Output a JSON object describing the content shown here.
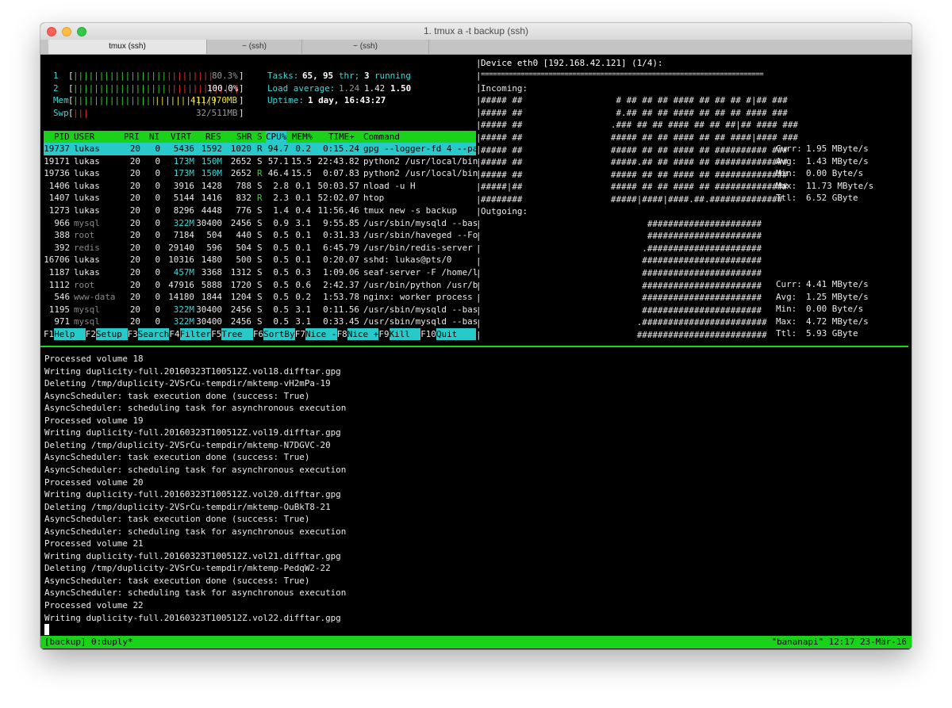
{
  "window": {
    "title": "1. tmux a -t backup (ssh)"
  },
  "tabs": [
    {
      "label": "tmux (ssh)"
    },
    {
      "label": "~ (ssh)"
    },
    {
      "label": "~ (ssh)"
    }
  ],
  "htop": {
    "cpu1": {
      "label": "1",
      "percent_text": "80.3%",
      "percent": 80.3
    },
    "cpu2": {
      "label": "2",
      "percent_text": "100.0%",
      "percent": 100.0
    },
    "mem": {
      "label": "Mem",
      "text": "411/970MB",
      "used": 411,
      "total": 970
    },
    "swp": {
      "label": "Swp",
      "text": "32/511MB",
      "used": 32,
      "total": 511
    },
    "tasks": {
      "label": "Tasks:",
      "count": "65,",
      "thr": "95",
      "thr_label": "thr;",
      "running": "3",
      "running_label": "running"
    },
    "load": {
      "label": "Load average:",
      "v1": "1.24",
      "v2": "1.42",
      "v3": "1.50"
    },
    "uptime": {
      "label": "Uptime:",
      "value": "1 day, 16:43:27"
    },
    "columns": [
      "PID",
      "USER",
      "PRI",
      "NI",
      "VIRT",
      "RES",
      "SHR",
      "S",
      "CPU%",
      "MEM%",
      "TIME+",
      "Command"
    ],
    "processes": [
      {
        "pid": "19737",
        "user": "lukas",
        "pri": "20",
        "ni": "0",
        "virt": "5436",
        "res": "1592",
        "shr": "1020",
        "s": "R",
        "cpu": "94.7",
        "mem": "0.2",
        "time": "0:15.24",
        "cmd": "gpg --logger-fd 4 --pa"
      },
      {
        "pid": "19171",
        "user": "lukas",
        "pri": "20",
        "ni": "0",
        "virt": "173M",
        "res": "150M",
        "shr": "2652",
        "s": "S",
        "cpu": "57.1",
        "mem": "15.5",
        "time": "22:43.82",
        "cmd": "python2 /usr/local/bin"
      },
      {
        "pid": "19736",
        "user": "lukas",
        "pri": "20",
        "ni": "0",
        "virt": "173M",
        "res": "150M",
        "shr": "2652",
        "s": "R",
        "cpu": "46.4",
        "mem": "15.5",
        "time": "0:07.83",
        "cmd": "python2 /usr/local/bin"
      },
      {
        "pid": "1406",
        "user": "lukas",
        "pri": "20",
        "ni": "0",
        "virt": "3916",
        "res": "1428",
        "shr": "788",
        "s": "S",
        "cpu": "2.8",
        "mem": "0.1",
        "time": "50:03.57",
        "cmd": "nload -u H"
      },
      {
        "pid": "1407",
        "user": "lukas",
        "pri": "20",
        "ni": "0",
        "virt": "5144",
        "res": "1416",
        "shr": "832",
        "s": "R",
        "cpu": "2.3",
        "mem": "0.1",
        "time": "52:02.07",
        "cmd": "htop"
      },
      {
        "pid": "1273",
        "user": "lukas",
        "pri": "20",
        "ni": "0",
        "virt": "8296",
        "res": "4448",
        "shr": "776",
        "s": "S",
        "cpu": "1.4",
        "mem": "0.4",
        "time": "11:56.46",
        "cmd": "tmux new -s backup"
      },
      {
        "pid": "966",
        "user": "mysql",
        "pri": "20",
        "ni": "0",
        "virt": "322M",
        "res": "30400",
        "shr": "2456",
        "s": "S",
        "cpu": "0.9",
        "mem": "3.1",
        "time": "9:55.85",
        "cmd": "/usr/sbin/mysqld --bas"
      },
      {
        "pid": "388",
        "user": "root",
        "pri": "20",
        "ni": "0",
        "virt": "7184",
        "res": "504",
        "shr": "440",
        "s": "S",
        "cpu": "0.5",
        "mem": "0.1",
        "time": "0:31.33",
        "cmd": "/usr/sbin/haveged --Fo"
      },
      {
        "pid": "392",
        "user": "redis",
        "pri": "20",
        "ni": "0",
        "virt": "29140",
        "res": "596",
        "shr": "504",
        "s": "S",
        "cpu": "0.5",
        "mem": "0.1",
        "time": "6:45.79",
        "cmd": "/usr/bin/redis-server"
      },
      {
        "pid": "16706",
        "user": "lukas",
        "pri": "20",
        "ni": "0",
        "virt": "10316",
        "res": "1480",
        "shr": "500",
        "s": "S",
        "cpu": "0.5",
        "mem": "0.1",
        "time": "0:20.07",
        "cmd": "sshd: lukas@pts/0"
      },
      {
        "pid": "1187",
        "user": "lukas",
        "pri": "20",
        "ni": "0",
        "virt": "457M",
        "res": "3368",
        "shr": "1312",
        "s": "S",
        "cpu": "0.5",
        "mem": "0.3",
        "time": "1:09.06",
        "cmd": "seaf-server -F /home/l"
      },
      {
        "pid": "1112",
        "user": "root",
        "pri": "20",
        "ni": "0",
        "virt": "47916",
        "res": "5888",
        "shr": "1720",
        "s": "S",
        "cpu": "0.5",
        "mem": "0.6",
        "time": "2:42.37",
        "cmd": "/usr/bin/python /usr/b"
      },
      {
        "pid": "546",
        "user": "www-data",
        "pri": "20",
        "ni": "0",
        "virt": "14180",
        "res": "1844",
        "shr": "1204",
        "s": "S",
        "cpu": "0.5",
        "mem": "0.2",
        "time": "1:53.78",
        "cmd": "nginx: worker process"
      },
      {
        "pid": "1195",
        "user": "mysql",
        "pri": "20",
        "ni": "0",
        "virt": "322M",
        "res": "30400",
        "shr": "2456",
        "s": "S",
        "cpu": "0.5",
        "mem": "3.1",
        "time": "0:11.56",
        "cmd": "/usr/sbin/mysqld --bas"
      },
      {
        "pid": "971",
        "user": "mysql",
        "pri": "20",
        "ni": "0",
        "virt": "322M",
        "res": "30400",
        "shr": "2456",
        "s": "S",
        "cpu": "0.5",
        "mem": "3.1",
        "time": "0:33.45",
        "cmd": "/usr/sbin/mysqld --bas"
      }
    ],
    "fkeys": [
      {
        "key": "F1",
        "label": "Help"
      },
      {
        "key": "F2",
        "label": "Setup"
      },
      {
        "key": "F3",
        "label": "Search"
      },
      {
        "key": "F4",
        "label": "Filter"
      },
      {
        "key": "F5",
        "label": "Tree"
      },
      {
        "key": "F6",
        "label": "SortBy"
      },
      {
        "key": "F7",
        "label": "Nice -"
      },
      {
        "key": "F8",
        "label": "Nice +"
      },
      {
        "key": "F9",
        "label": "Kill"
      },
      {
        "key": "F10",
        "label": "Quit"
      }
    ]
  },
  "nload": {
    "device_line": "Device eth0 [192.168.42.121] (1/4):",
    "separator": "=======================================================================",
    "incoming_label": "Incoming:",
    "outgoing_label": "Outgoing:",
    "incoming_graph": [
      "##### ##                  # ## ## ## #### ## ## ## #|## ###",
      "##### ##                  #.## ## ## #### ## ## ## #### ###",
      "##### ##                 .### ## ## #### ## ## ##|## #### ###",
      "##### ##                 ##### ## ## #### ## ## ####|#### ###",
      "##### ##                 ##### ## ## #### ## ########## ###",
      "##### ##                 #####.## ## #### ## ##############",
      "##### ##                 ##### ## ## #### ## ##############",
      "#####|##                 ##### ## ## #### ## ##############",
      "########                 #####|####|####.##.##############"
    ],
    "outgoing_graph": [
      "                                ######################",
      "                                ######################",
      "                               .######################",
      "                               #######################",
      "                               #######################",
      "                               #######################",
      "                               #######################",
      "                               #######################",
      "                              .########################",
      "                              #########################"
    ],
    "incoming_stats": [
      {
        "label": "Curr:",
        "value": "1.95 MByte/s"
      },
      {
        "label": "Avg:",
        "value": "1.43 MByte/s"
      },
      {
        "label": "Min:",
        "value": "0.00 Byte/s"
      },
      {
        "label": "Max:",
        "value": "11.73 MByte/s"
      },
      {
        "label": "Ttl:",
        "value": "6.52 GByte"
      }
    ],
    "outgoing_stats": [
      {
        "label": "Curr:",
        "value": "4.41 MByte/s"
      },
      {
        "label": "Avg:",
        "value": "1.25 MByte/s"
      },
      {
        "label": "Min:",
        "value": "0.00 Byte/s"
      },
      {
        "label": "Max:",
        "value": "4.72 MByte/s"
      },
      {
        "label": "Ttl:",
        "value": "5.93 GByte"
      }
    ]
  },
  "log": [
    "Processed volume 18",
    "Writing duplicity-full.20160323T100512Z.vol18.difftar.gpg",
    "Deleting /tmp/duplicity-2VSrCu-tempdir/mktemp-vH2mPa-19",
    "AsyncScheduler: task execution done (success: True)",
    "AsyncScheduler: scheduling task for asynchronous execution",
    "Processed volume 19",
    "Writing duplicity-full.20160323T100512Z.vol19.difftar.gpg",
    "Deleting /tmp/duplicity-2VSrCu-tempdir/mktemp-N7DGVC-20",
    "AsyncScheduler: task execution done (success: True)",
    "AsyncScheduler: scheduling task for asynchronous execution",
    "Processed volume 20",
    "Writing duplicity-full.20160323T100512Z.vol20.difftar.gpg",
    "Deleting /tmp/duplicity-2VSrCu-tempdir/mktemp-OuBkT8-21",
    "AsyncScheduler: task execution done (success: True)",
    "AsyncScheduler: scheduling task for asynchronous execution",
    "Processed volume 21",
    "Writing duplicity-full.20160323T100512Z.vol21.difftar.gpg",
    "Deleting /tmp/duplicity-2VSrCu-tempdir/mktemp-PedqW2-22",
    "AsyncScheduler: task execution done (success: True)",
    "AsyncScheduler: scheduling task for asynchronous execution",
    "Processed volume 22",
    "Writing duplicity-full.20160323T100512Z.vol22.difftar.gpg"
  ],
  "tmux_status": {
    "left": "[backup] 0:duply*",
    "right": "\"bananapi\" 12:17 23-Mär-16"
  },
  "colors": {
    "accent_green": "#19d219",
    "accent_cyan": "#27c9c9",
    "cpu_bar_green": "#3bd23b",
    "cpu_bar_red": "#e8302b",
    "mem_bar_yellow": "#e8e23a",
    "terminal_bg": "#000000"
  }
}
